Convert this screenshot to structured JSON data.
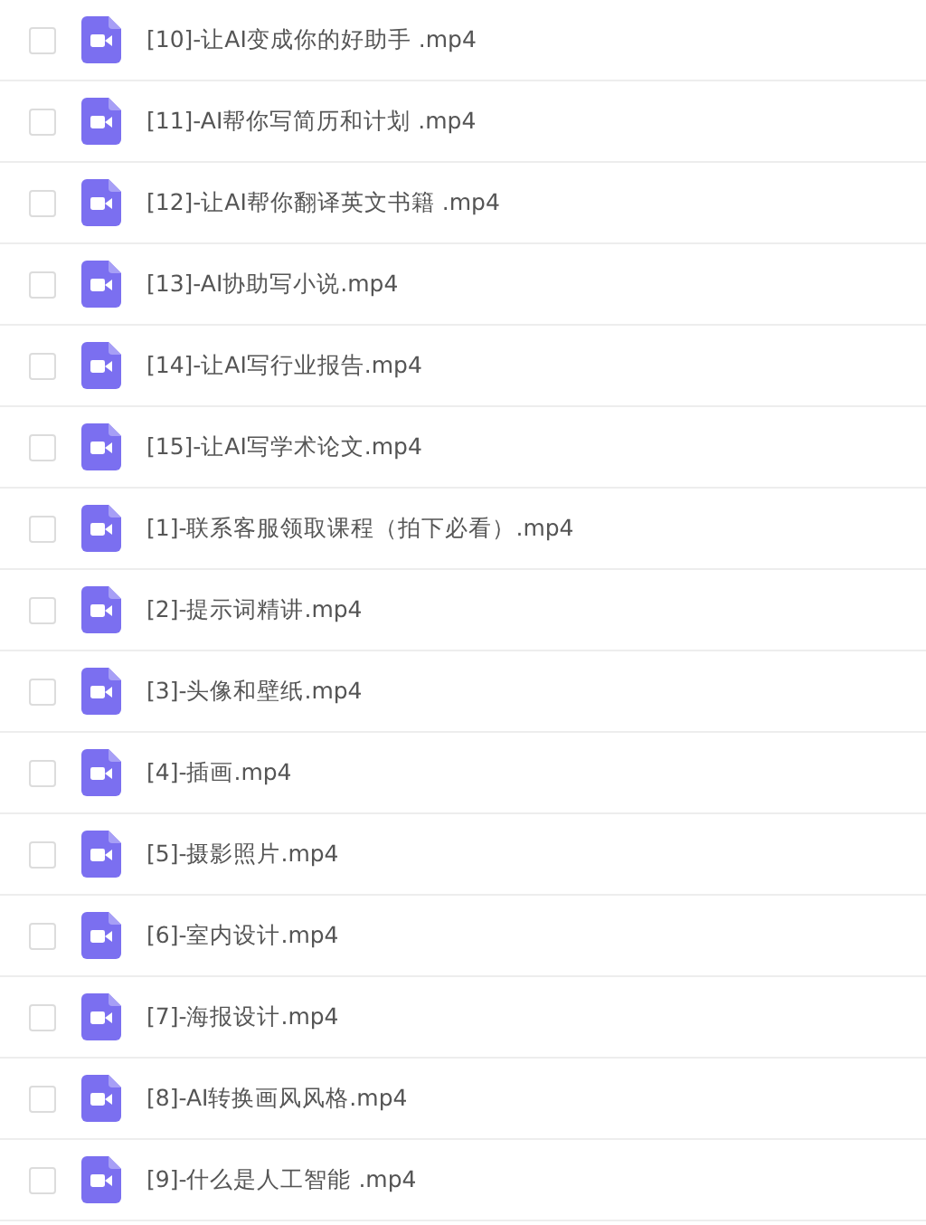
{
  "files": [
    {
      "name": "[10]-让AI变成你的好助手 .mp4",
      "checked": false
    },
    {
      "name": "[11]-AI帮你写简历和计划 .mp4",
      "checked": false
    },
    {
      "name": "[12]-让AI帮你翻译英文书籍 .mp4",
      "checked": false
    },
    {
      "name": "[13]-AI协助写小说.mp4",
      "checked": false
    },
    {
      "name": "[14]-让AI写行业报告.mp4",
      "checked": false
    },
    {
      "name": "[15]-让AI写学术论文.mp4",
      "checked": false
    },
    {
      "name": "[1]-联系客服领取课程（拍下必看）.mp4",
      "checked": false
    },
    {
      "name": "[2]-提示词精讲.mp4",
      "checked": false
    },
    {
      "name": "[3]-头像和壁纸.mp4",
      "checked": false
    },
    {
      "name": "[4]-插画.mp4",
      "checked": false
    },
    {
      "name": "[5]-摄影照片.mp4",
      "checked": false
    },
    {
      "name": "[6]-室内设计.mp4",
      "checked": false
    },
    {
      "name": "[7]-海报设计.mp4",
      "checked": false
    },
    {
      "name": "[8]-AI转换画风风格.mp4",
      "checked": false
    },
    {
      "name": "[9]-什么是人工智能 .mp4",
      "checked": false
    }
  ]
}
